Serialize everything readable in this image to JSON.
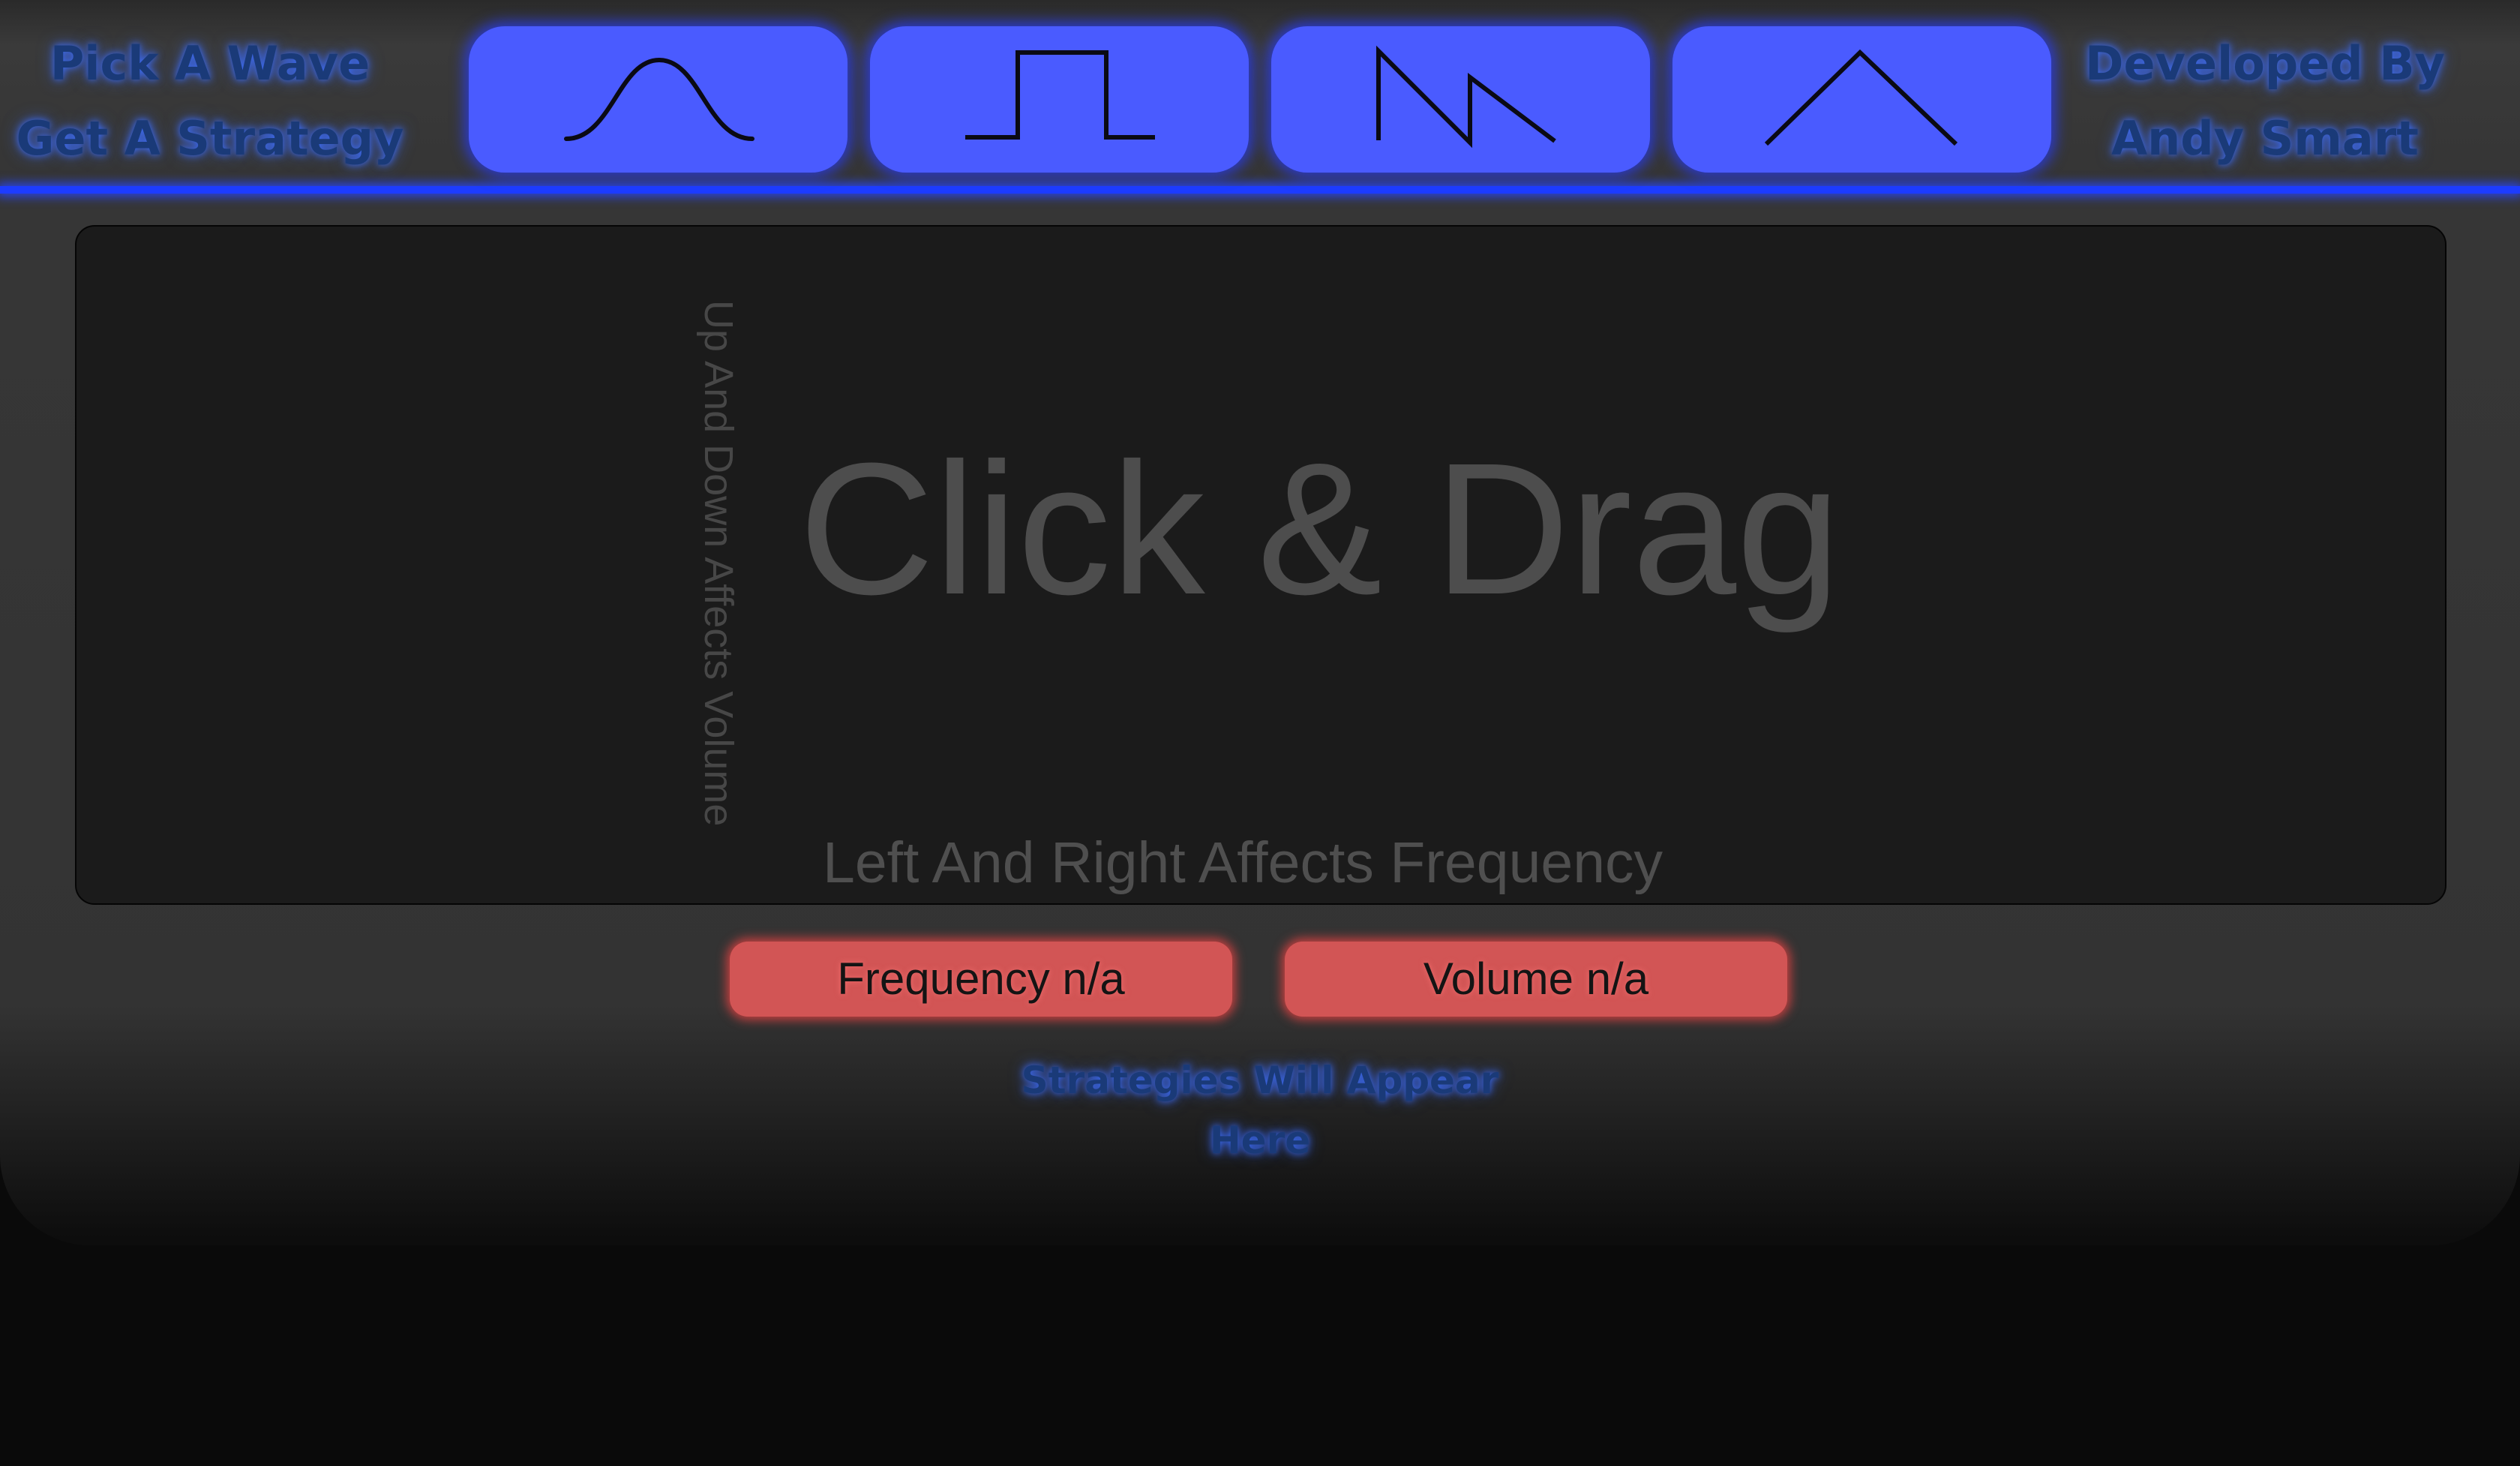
{
  "header": {
    "left_line1": "Pick A Wave",
    "left_line2": "Get A Strategy",
    "right_line1": "Developed By",
    "right_line2": "Andy Smart"
  },
  "wave_buttons": [
    {
      "icon": "sine-wave-icon"
    },
    {
      "icon": "square-wave-icon"
    },
    {
      "icon": "sawtooth-wave-icon"
    },
    {
      "icon": "triangle-wave-icon"
    }
  ],
  "pad": {
    "title": "Click & Drag",
    "vertical_hint": "Up And Down Affects Volume",
    "horizontal_hint": "Left And Right Affects Frequency"
  },
  "readouts": {
    "frequency": "Frequency n/a",
    "volume": "Volume n/a"
  },
  "strategy_text": "Strategies Will Appear Here",
  "colors": {
    "accent_blue": "#4a5bff",
    "glow_blue": "#1d3cff",
    "readout_red": "#d25555",
    "pad_bg": "#1b1b1b"
  }
}
